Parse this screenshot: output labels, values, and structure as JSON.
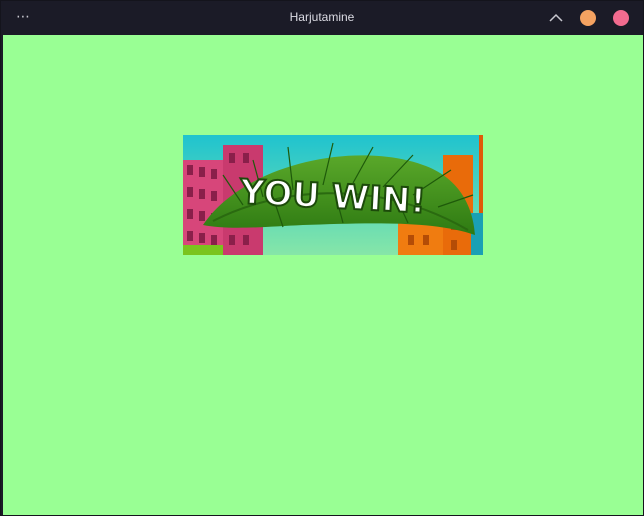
{
  "window": {
    "title": "Harjutamine",
    "menu_icon": "ellipsis-icon",
    "collapse_icon": "chevron-up-icon",
    "minimize_color": "#f4a261",
    "close_color": "#f26b8f"
  },
  "content": {
    "background": "#99ff94",
    "banner": {
      "text": "YOU WIN!"
    }
  }
}
